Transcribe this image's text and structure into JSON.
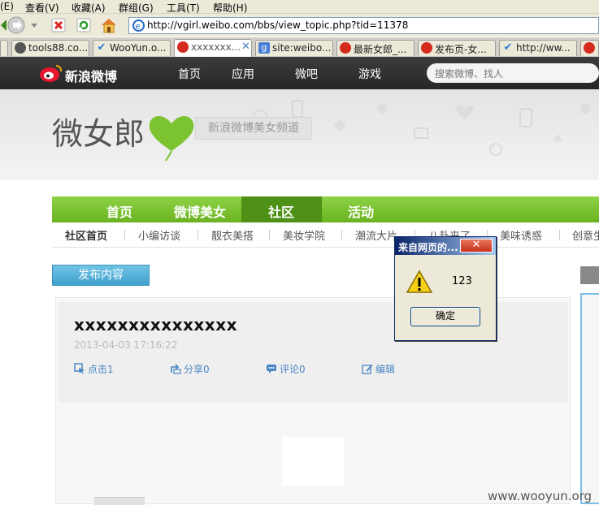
{
  "browser": {
    "menu": [
      "(E)",
      "查看(V)",
      "收藏(A)",
      "群组(G)",
      "工具(T)",
      "帮助(H)"
    ],
    "address": "http://vgirl.weibo.com/bbs/view_topic.php?tid=11378",
    "tabs": [
      {
        "label": "tools88.co...",
        "icon_color": "#555555"
      },
      {
        "label": "WooYun.o...",
        "icon_color": "#2a7fd4"
      },
      {
        "label": "xxxxxxx...",
        "icon_color": "#d52b1e",
        "active": true
      },
      {
        "label": "site:weibo...",
        "icon_color": "#4285f4"
      },
      {
        "label": "最新女郎_...",
        "icon_color": "#d52b1e"
      },
      {
        "label": "发布页-女...",
        "icon_color": "#d52b1e"
      },
      {
        "label": "http://ww...",
        "icon_color": "#2a7fd4"
      },
      {
        "label": "",
        "icon_color": "#d52b1e"
      }
    ]
  },
  "weibo": {
    "logo_text": "新浪微博",
    "nav": [
      "首页",
      "应用",
      "微吧",
      "游戏"
    ],
    "search_placeholder": "搜索微博、找人"
  },
  "banner": {
    "title": "微女郎",
    "tagline": "新浪微博美女频道",
    "heart_color": "#7cc332"
  },
  "green_nav": {
    "items": [
      "首页",
      "微博美女",
      "社区",
      "活动"
    ],
    "active": "社区"
  },
  "sub_nav": [
    "社区首页",
    "小编访谈",
    "靓衣美搭",
    "美妆学院",
    "潮流大片",
    "八卦来了",
    "美味诱惑",
    "创意生"
  ],
  "publish_button": "发布内容",
  "post": {
    "title": "xxxxxxxxxxxxxxx",
    "date": "2013-04-03 17:16:22",
    "actions": [
      {
        "label": "点击1",
        "icon": "click-icon"
      },
      {
        "label": "分享0",
        "icon": "share-icon"
      },
      {
        "label": "评论0",
        "icon": "comment-icon"
      },
      {
        "label": "编辑",
        "icon": "edit-icon"
      }
    ]
  },
  "alert": {
    "title": "来自网页的...",
    "message": "123",
    "ok_label": "确定",
    "icon": "warning-icon"
  },
  "watermark": "www.wooyun.org"
}
